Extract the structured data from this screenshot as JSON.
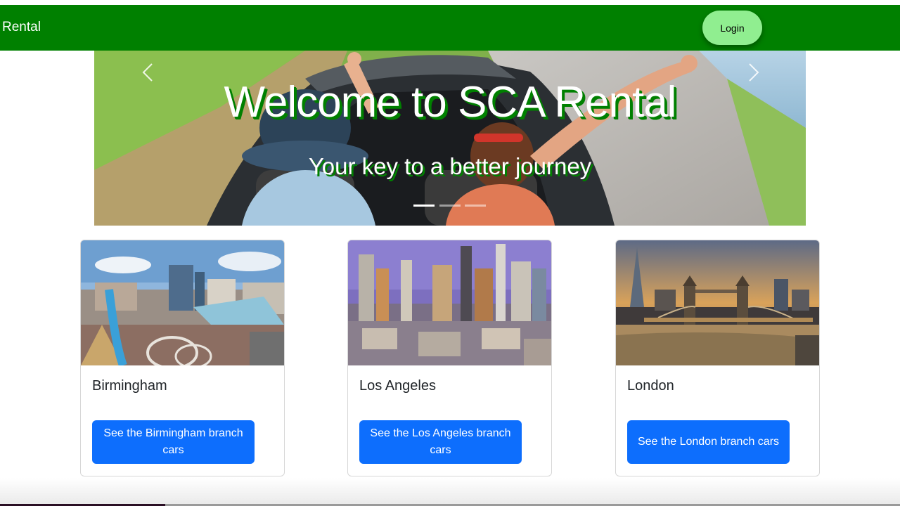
{
  "navbar": {
    "brand": "Rental",
    "login_label": "Login",
    "background_color": "#008000",
    "login_color": "#90ee90"
  },
  "carousel": {
    "title": "Welcome to SCA Rental",
    "subtitle": "Your key to a better journey",
    "slide_count": 3,
    "active_slide": 1,
    "prev_icon": "chevron-left-icon",
    "next_icon": "chevron-right-icon"
  },
  "cards": [
    {
      "city": "Birmingham",
      "button_label": "See the Birmingham branch cars"
    },
    {
      "city": "Los Angeles",
      "button_label": "See the Los Angeles branch cars"
    },
    {
      "city": "London",
      "button_label": "See the London branch cars"
    }
  ],
  "colors": {
    "accent_green": "#008000",
    "button_blue": "#0d6efd"
  }
}
